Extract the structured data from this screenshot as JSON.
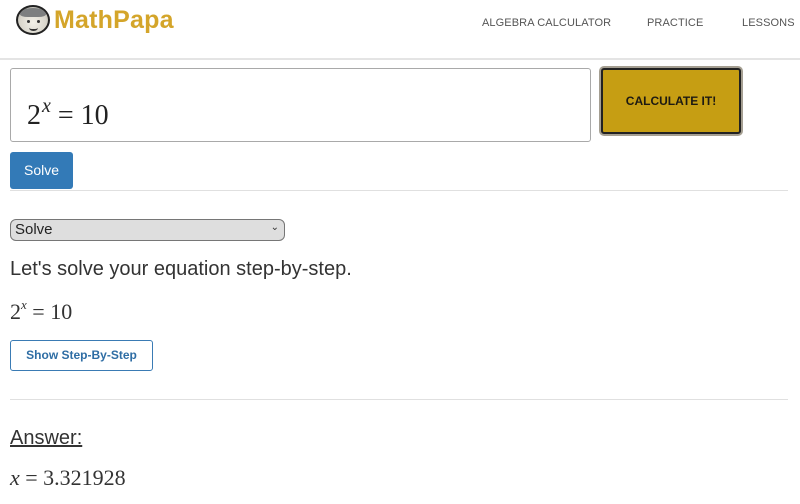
{
  "header": {
    "brand": "MathPapa",
    "logo_icon": "cartoon-face-logo",
    "nav": [
      {
        "label": "ALGEBRA CALCULATOR"
      },
      {
        "label": "PRACTICE"
      },
      {
        "label": "LESSONS"
      }
    ]
  },
  "calculator": {
    "input": {
      "base": "2",
      "exponent": "x",
      "rest": " = 10"
    },
    "calculate_label": "CALCULATE IT!",
    "solve_label": "Solve",
    "accent_color": "#c69e13",
    "primary_color": "#337ab7"
  },
  "result": {
    "mode_select": {
      "selected": "Solve",
      "chevron_icon": "chevron-down-icon"
    },
    "intro": "Let's solve your equation step-by-step.",
    "equation": {
      "base": "2",
      "exponent": "x",
      "rest": " = 10"
    },
    "show_steps_label": "Show Step-By-Step",
    "answer_label": "Answer:",
    "answer": {
      "variable": "x",
      "value": " = 3.321928"
    }
  }
}
